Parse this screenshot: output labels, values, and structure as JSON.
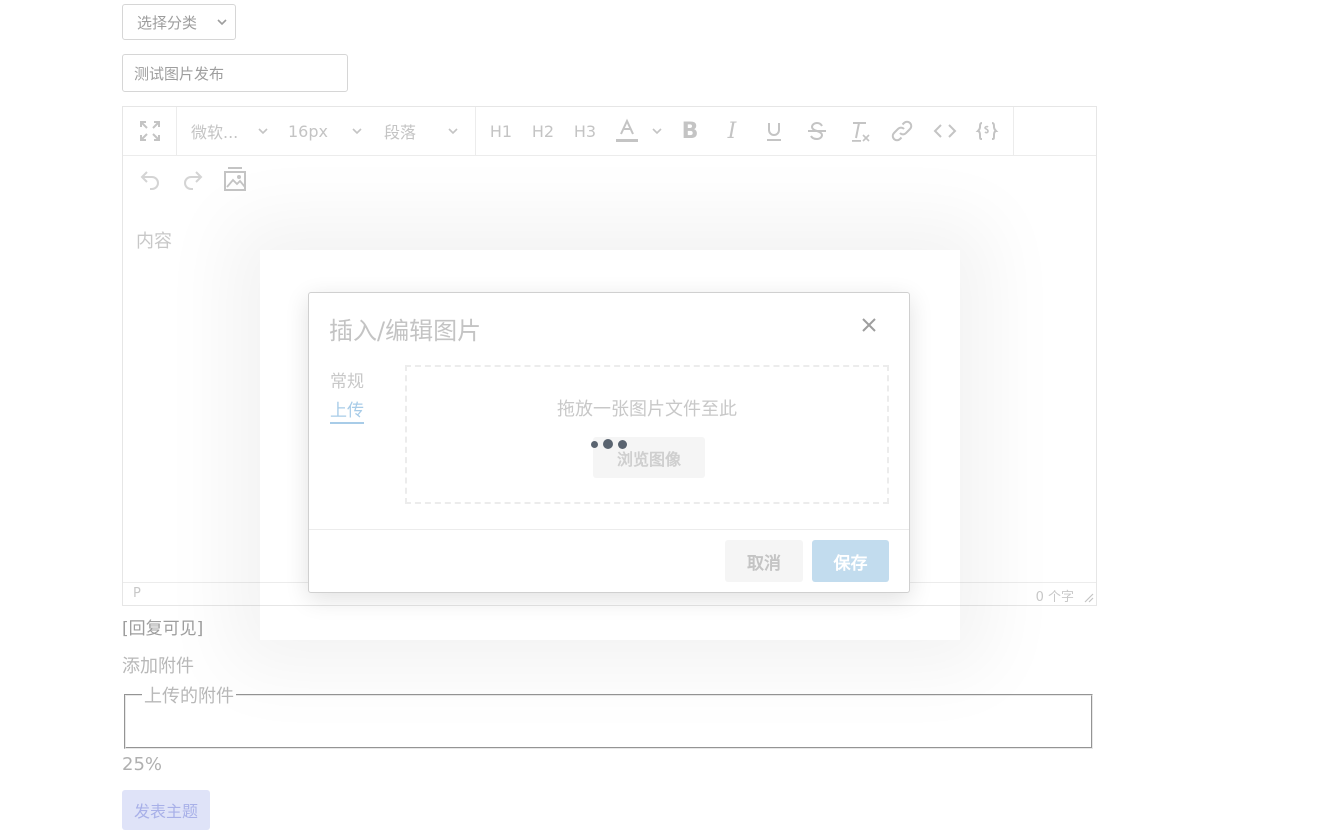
{
  "category_select": {
    "selected": "选择分类"
  },
  "title_input": {
    "value": "测试图片发布"
  },
  "editor": {
    "toolbar": {
      "font_family": "微软...",
      "font_size": "16px",
      "block_format": "段落",
      "h1": "H1",
      "h2": "H2",
      "h3": "H3"
    },
    "placeholder": "内容",
    "statusbar": {
      "path": "P",
      "word_count": "0 个字"
    }
  },
  "reply_visible": "[回复可见]",
  "add_attachment": "添加附件",
  "attachments": {
    "legend": "上传的附件"
  },
  "upload_progress": "25%",
  "publish_button": "发表主题",
  "dialog": {
    "title": "插入/编辑图片",
    "tabs": [
      "常规",
      "上传"
    ],
    "active_tab": "上传",
    "dropzone_text": "拖放一张图片文件至此",
    "browse_button": "浏览图像",
    "cancel_button": "取消",
    "save_button": "保存"
  },
  "colors": {
    "save": "#c2dcee",
    "publish": "#dfe3f8",
    "upload_tab": "#a8cce8"
  }
}
